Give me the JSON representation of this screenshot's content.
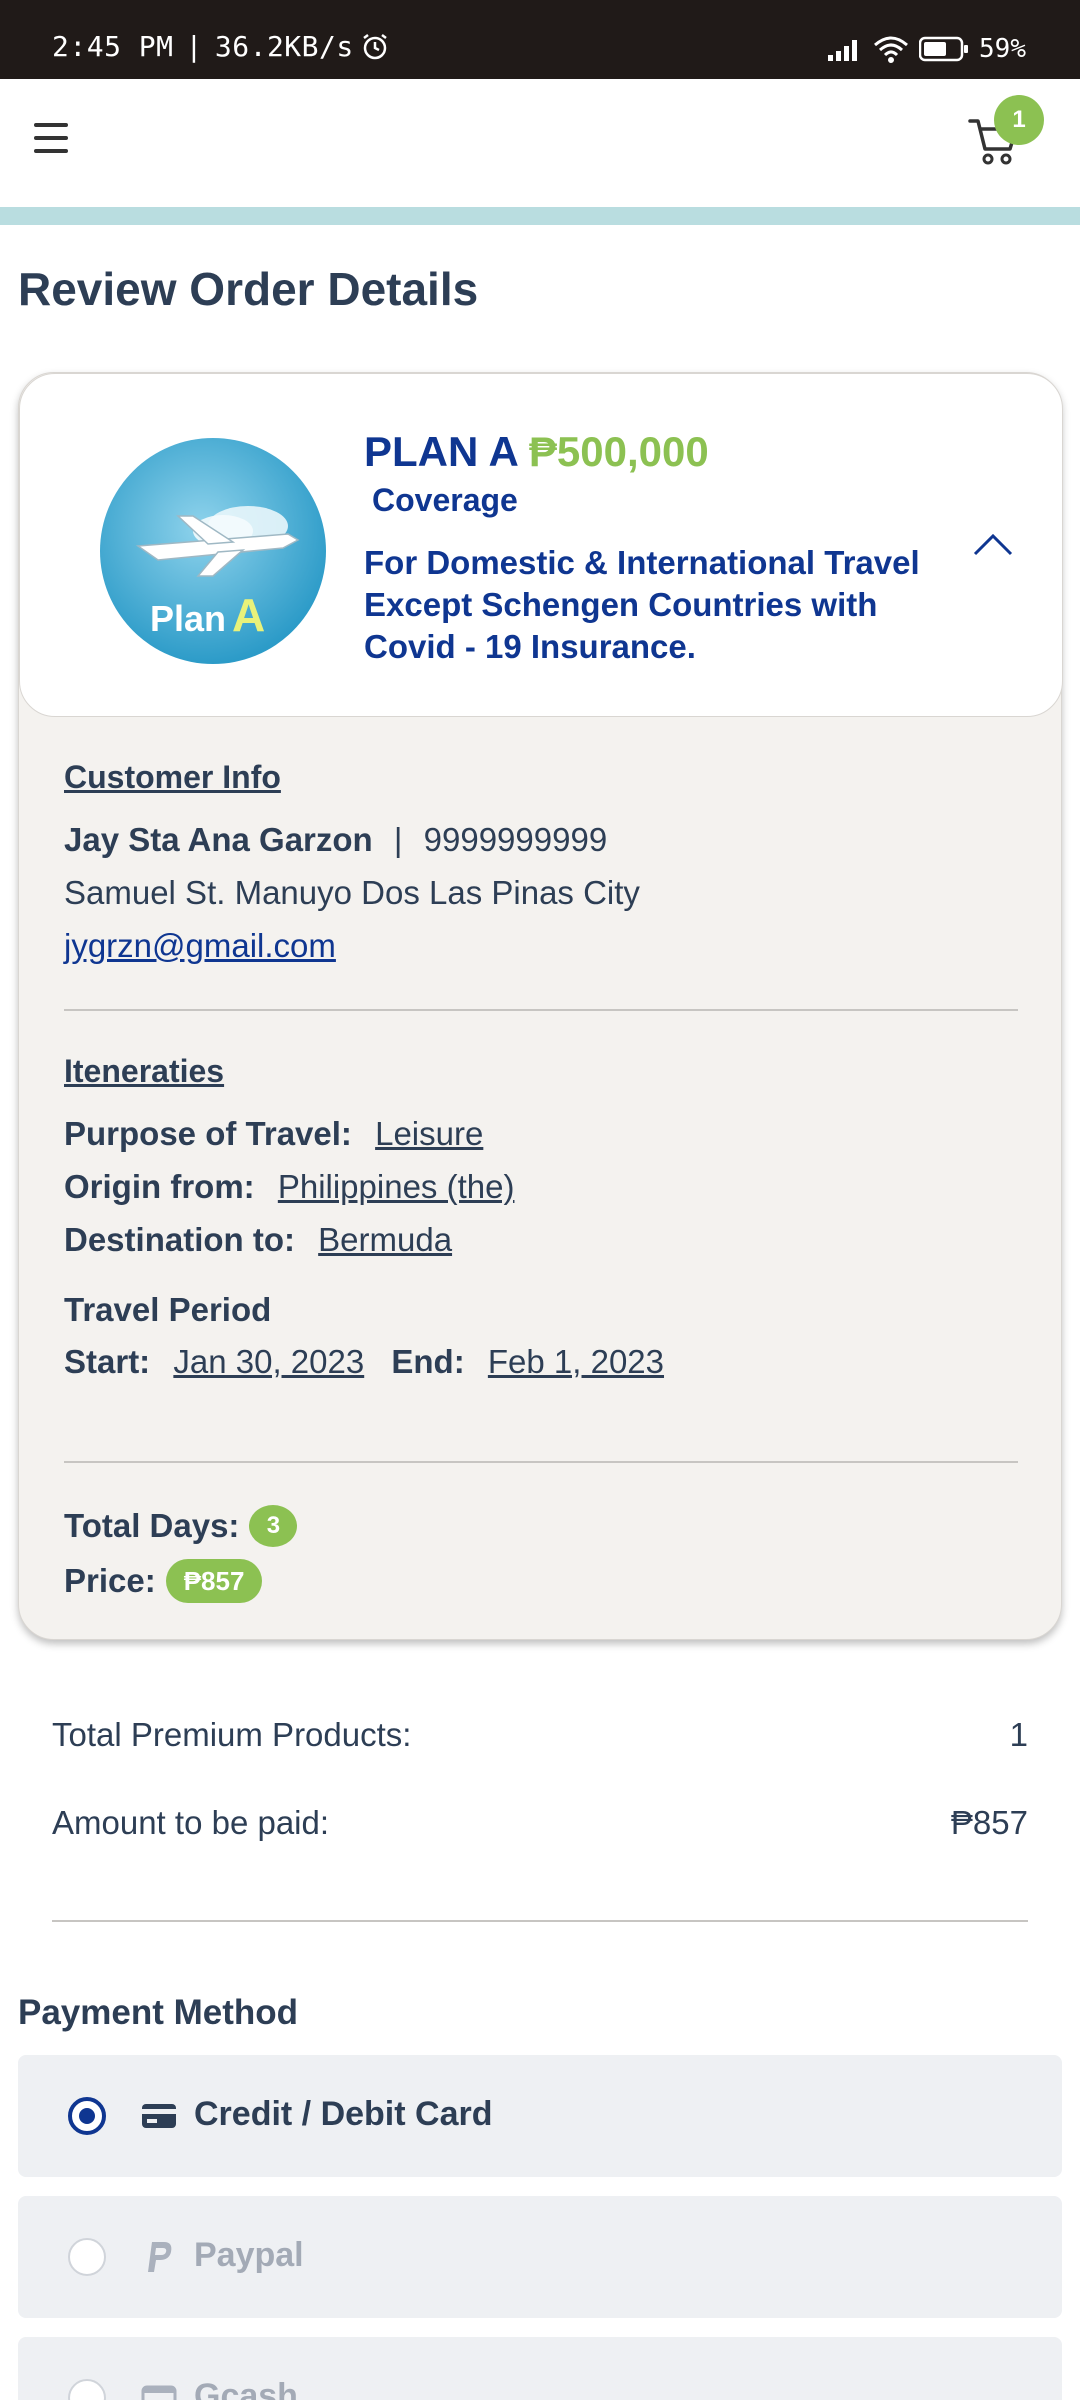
{
  "status_bar": {
    "time": "2:45 PM",
    "separator": "|",
    "speed": "36.2KB/s",
    "battery": "59%"
  },
  "header": {
    "cart_count": "1"
  },
  "page_title": "Review Order Details",
  "plan": {
    "name": "PLAN A",
    "amount": "₱500,000",
    "coverage_label": "Coverage",
    "description": "For Domestic & International Travel Except Schengen Countries with Covid - 19 Insurance.",
    "logo_text_plan": "Plan",
    "logo_text_letter": "A"
  },
  "customer": {
    "heading": "Customer Info",
    "name": "Jay Sta Ana Garzon",
    "separator": "|",
    "phone": "9999999999",
    "address": "Samuel St. Manuyo Dos Las Pinas City",
    "email": "jygrzn@gmail.com"
  },
  "itinerary": {
    "heading": "Iteneraties",
    "purpose_label": "Purpose of Travel:",
    "purpose_value": "Leisure",
    "origin_label": "Origin from:",
    "origin_value": "Philippines (the)",
    "destination_label": "Destination to:",
    "destination_value": "Bermuda",
    "period_label": "Travel Period",
    "start_label": "Start:",
    "start_value": "Jan 30, 2023",
    "end_label": "End:",
    "end_value": "Feb 1, 2023"
  },
  "totals": {
    "days_label": "Total Days:",
    "days_value": "3",
    "price_label": "Price:",
    "price_value": "₱857"
  },
  "summary": {
    "products_label": "Total Premium Products:",
    "products_value": "1",
    "amount_label": "Amount to be paid:",
    "amount_value": "₱857"
  },
  "payment": {
    "heading": "Payment Method",
    "options": [
      {
        "label": "Credit / Debit Card",
        "selected": true,
        "icon": "credit-card-icon"
      },
      {
        "label": "Paypal",
        "selected": false,
        "icon": "paypal-icon"
      },
      {
        "label": "Gcash",
        "selected": false,
        "icon": "gcash-icon"
      }
    ]
  },
  "colors": {
    "primary_blue": "#0f3691",
    "accent_green": "#8cc152",
    "text_dark": "#2d3e55",
    "teal_strip": "#b9dde0",
    "status_bar": "#201a18"
  }
}
